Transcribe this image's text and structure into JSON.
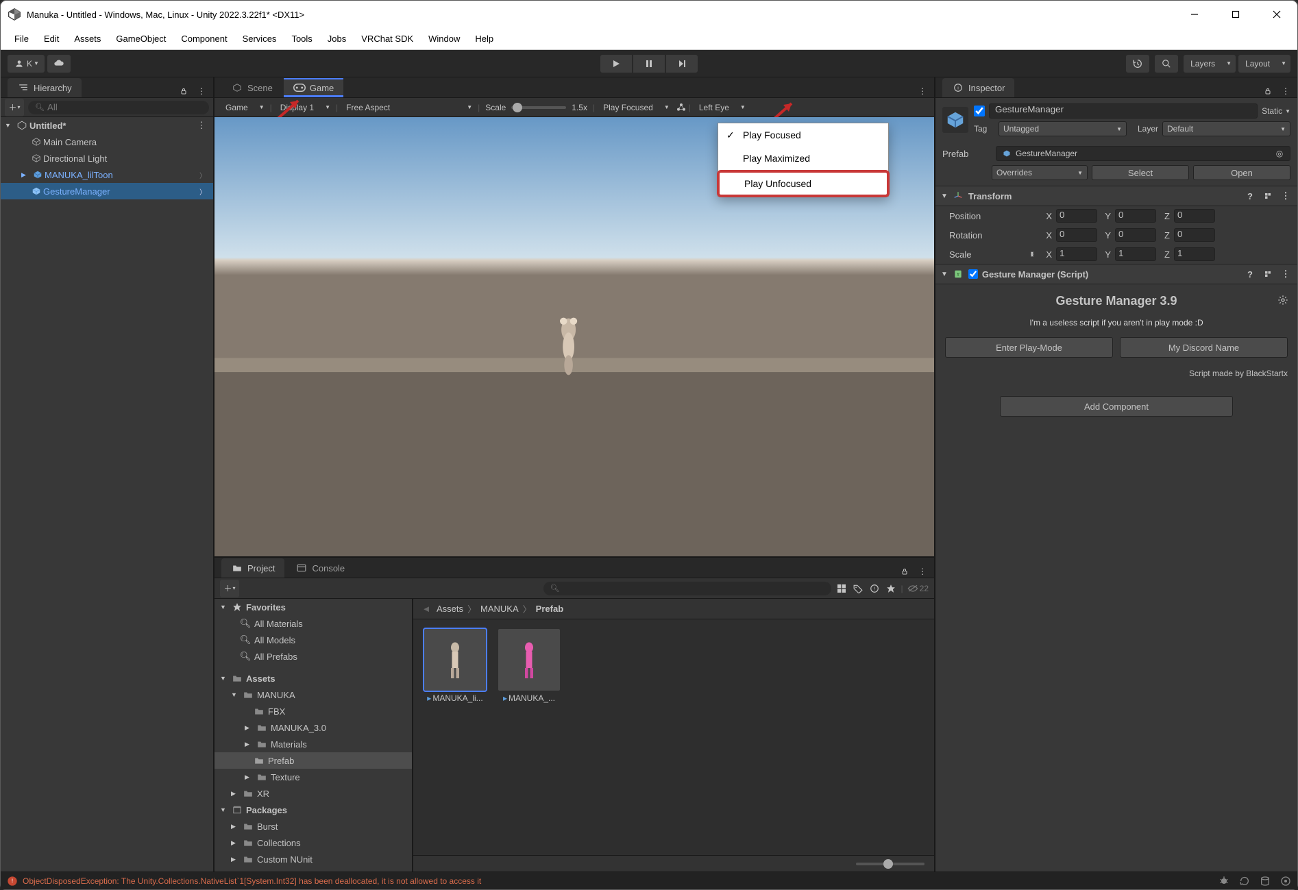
{
  "window": {
    "title": "Manuka - Untitled - Windows, Mac, Linux - Unity 2022.3.22f1* <DX11>"
  },
  "menubar": [
    "File",
    "Edit",
    "Assets",
    "GameObject",
    "Component",
    "Services",
    "Tools",
    "Jobs",
    "VRChat SDK",
    "Window",
    "Help"
  ],
  "toolbar": {
    "account": "K",
    "layers": "Layers",
    "layout": "Layout"
  },
  "hierarchy": {
    "title": "Hierarchy",
    "search_placeholder": "All",
    "scene": "Untitled*",
    "items": [
      "Main Camera",
      "Directional Light",
      "MANUKA_lilToon",
      "GestureManager"
    ]
  },
  "tabs": {
    "scene": "Scene",
    "game": "Game"
  },
  "game_toolbar": {
    "game": "Game",
    "display": "Display 1",
    "aspect": "Free Aspect",
    "scale_label": "Scale",
    "scale_value": "1.5x",
    "play_mode": "Play Focused",
    "eye": "Left Eye"
  },
  "play_menu": [
    "Play Focused",
    "Play Maximized",
    "Play Unfocused"
  ],
  "project": {
    "title": "Project",
    "console_title": "Console",
    "breadcrumb": [
      "Assets",
      "MANUKA",
      "Prefab"
    ],
    "hidden_count": "22",
    "favorites": {
      "label": "Favorites",
      "items": [
        "All Materials",
        "All Models",
        "All Prefabs"
      ]
    },
    "assets_root": "Assets",
    "tree": {
      "manuka": "MANUKA",
      "children": [
        "FBX",
        "MANUKA_3.0",
        "Materials",
        "Prefab",
        "Texture"
      ],
      "xr": "XR",
      "packages": "Packages",
      "pkg_children": [
        "Burst",
        "Collections",
        "Custom NUnit"
      ]
    },
    "assets": [
      "MANUKA_li...",
      "MANUKA_..."
    ]
  },
  "status": {
    "error": "ObjectDisposedException: The Unity.Collections.NativeList`1[System.Int32] has been deallocated, it is not allowed to access it"
  },
  "inspector": {
    "title": "Inspector",
    "name": "GestureManager",
    "static_label": "Static",
    "tag_label": "Tag",
    "tag_value": "Untagged",
    "layer_label": "Layer",
    "layer_value": "Default",
    "prefab_label": "Prefab",
    "prefab_value": "GestureManager",
    "overrides": "Overrides",
    "select_btn": "Select",
    "open_btn": "Open",
    "transform": {
      "title": "Transform",
      "position": "Position",
      "rotation": "Rotation",
      "scale": "Scale",
      "pos": {
        "x": "0",
        "y": "0",
        "z": "0"
      },
      "rot": {
        "x": "0",
        "y": "0",
        "z": "0"
      },
      "scl": {
        "x": "1",
        "y": "1",
        "z": "1"
      }
    },
    "gesture_comp": {
      "title": "Gesture Manager (Script)",
      "heading": "Gesture Manager 3.9",
      "desc": "I'm a useless script if you aren't in play mode :D",
      "enter_play": "Enter Play-Mode",
      "discord": "My Discord Name",
      "credits": "Script made by BlackStartx"
    },
    "add_component": "Add Component"
  }
}
